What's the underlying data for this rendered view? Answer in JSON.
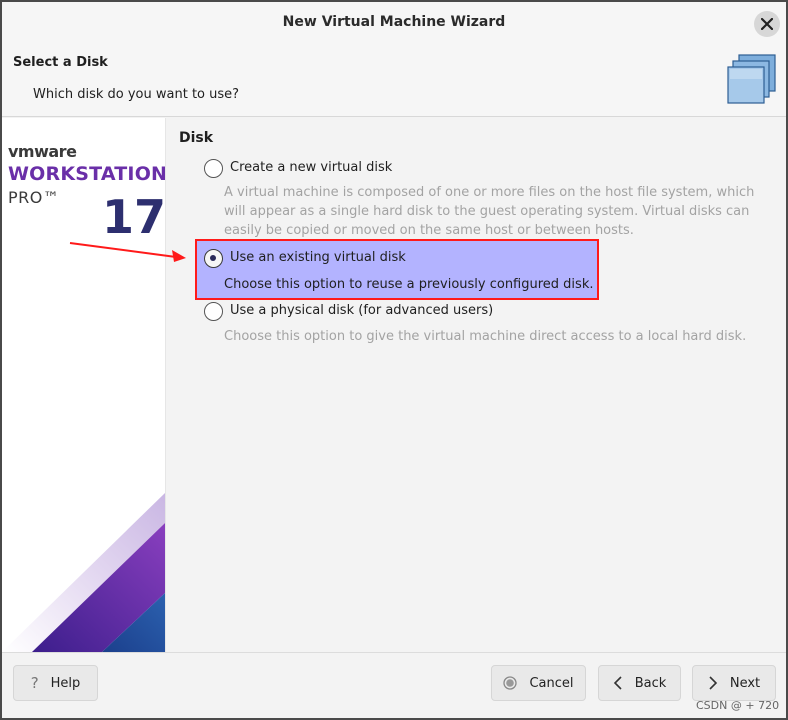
{
  "window": {
    "title": "New Virtual Machine Wizard"
  },
  "header": {
    "title": "Select a Disk",
    "subtitle": "Which disk do you want to use?",
    "icon": "disk-stack-icon"
  },
  "banner": {
    "brand_vmware": "vmware",
    "brand_product": "WORKSTATION",
    "brand_edition": "PRO™",
    "brand_version": "17"
  },
  "content": {
    "section_title": "Disk",
    "options": [
      {
        "label": "Create a new virtual disk",
        "description": "A virtual machine is composed of one or more files on the host file system, which will appear as a single hard disk to the guest operating system. Virtual disks can easily be copied or moved on the same host or between hosts.",
        "selected": false
      },
      {
        "label": "Use an existing virtual disk",
        "description": "Choose this option to reuse a previously configured disk.",
        "selected": true
      },
      {
        "label": "Use a physical disk (for advanced users)",
        "description": "Choose this option to give the virtual machine direct access to a local hard disk.",
        "selected": false
      }
    ],
    "highlight_color": "#b3b3ff",
    "annotation_color": "#ff1a1a"
  },
  "footer": {
    "help_label": "Help",
    "cancel_label": "Cancel",
    "back_label": "Back",
    "next_label": "Next"
  },
  "watermark": "CSDN @ + 720"
}
